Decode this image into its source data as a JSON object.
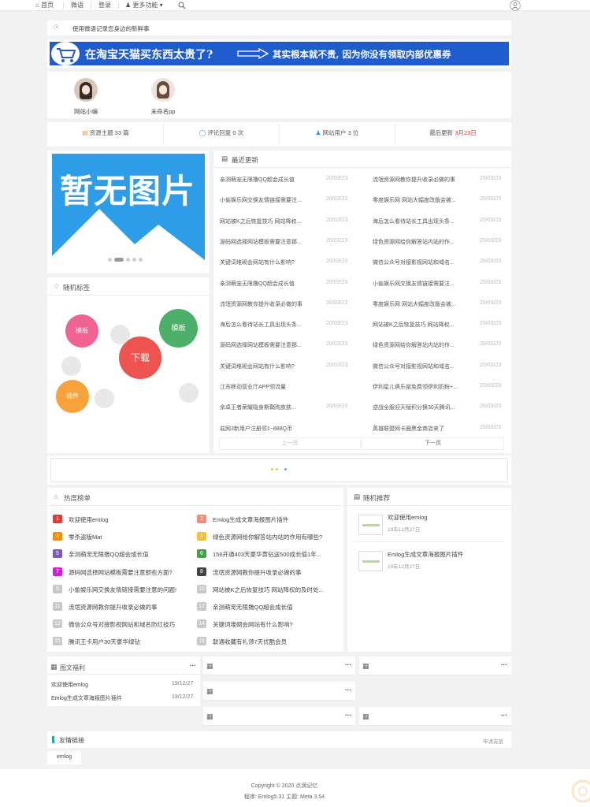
{
  "nav": {
    "home": "首页",
    "weibo": "微语",
    "login": "登录",
    "more": "更多功能"
  },
  "notice": "使用微语记录您身边的新鲜事",
  "banner": {
    "left": "在淘宝天猫买东西太贵了?",
    "right": "其实根本就不贵, 因为你没有领取内部优惠券",
    "color": "#1e5ccf"
  },
  "users": [
    {
      "name": "网站小编"
    },
    {
      "name": "未命名pp"
    }
  ],
  "stats": {
    "topics": "资源主题 33 篇",
    "comments": "评论回复 0 次",
    "users": "网站用户 3 位",
    "updated_label": "最后更新",
    "updated_date": "3月23日"
  },
  "placeholder_text": "暂无图片",
  "recent": {
    "title": "最近更新",
    "items": [
      [
        "亲测萌宠无限撸QQ超会成长值",
        "20/03/23",
        "流氓资源网教你提升收录必做的事",
        "20/03/23"
      ],
      [
        "小偷娱乐网交换友情链接需要注...",
        "20/03/23",
        "零度娱乐网 网站大幅度改版会被...",
        "20/03/23"
      ],
      [
        "网站被K之后恢复技巧 网站降权...",
        "20/03/23",
        "海后怎么看待站长工具出现头条...",
        "20/03/23"
      ],
      [
        "源码网选择网站模板需要注意那...",
        "20/03/23",
        "绿色资源网给你解答站内站的作...",
        "20/03/23"
      ],
      [
        "关键词堆砌会网站有什么影响?",
        "20/03/23",
        "微信公众号对接影视网站和域名...",
        "20/03/23"
      ],
      [
        "亲测萌宠无限撸QQ超会成长值",
        "20/03/23",
        "小偷娱乐网交换友情链接需要注...",
        "20/03/23"
      ],
      [
        "流氓资源网教你提升收录必做的事",
        "20/03/23",
        "零度娱乐网 网站大幅度改版会被...",
        "20/03/23"
      ],
      [
        "海后怎么看待站长工具出现头条...",
        "20/03/23",
        "网站被K之后恢复技巧 网站降权...",
        "20/03/23"
      ],
      [
        "源码网选择网站模板需要注意那...",
        "20/03/23",
        "绿色资源网给你解答站内站的作...",
        "20/03/23"
      ],
      [
        "关键词堆砌会网站有什么影响?",
        "20/03/23",
        "微信公众号对接影视网站和域名...",
        "20/03/23"
      ],
      [
        "江苏移动营业厅APP领流量",
        "",
        "伊利星儿俱乐部免费领伊利奶粉+...",
        "20/03/23"
      ],
      [
        "余卓王者荣耀隐身斯鞘殉皮肤...",
        "20/03/23",
        "逆战全服迎天赋积分换30天腾讯...",
        "20/03/23"
      ],
      [
        "兹网3新用户注册领1~888Q币",
        "",
        "英雄联盟网卡圈黑金商店来了",
        "20/03/23"
      ]
    ],
    "prev": "上一页",
    "next": "下一页"
  },
  "tags": {
    "title": "随机标签",
    "items": [
      {
        "label": "模板",
        "color": "#f06292"
      },
      {
        "label": "模板",
        "color": "#4caf6a"
      },
      {
        "label": "下载",
        "color": "#ef5350"
      },
      {
        "label": "插件",
        "color": "#f7a23a"
      }
    ]
  },
  "hot": {
    "title": "热度榜单",
    "items": [
      {
        "n": "1",
        "t": "欢迎使用emlog",
        "c": "#e53935"
      },
      {
        "n": "2",
        "t": "Emlog生成文章海报图片插件",
        "c": "#f28c7f"
      },
      {
        "n": "3",
        "t": "零杀盗版Mat",
        "c": "#fb8c00"
      },
      {
        "n": "4",
        "t": "绿色资源网给你解答站内站的作用有哪些?",
        "c": "#fbc02d"
      },
      {
        "n": "5",
        "t": "亲测萌宠无限撸QQ超会成长值",
        "c": "#7e57c2"
      },
      {
        "n": "6",
        "t": "156开通403天豪华黄钻送500成长值1年...",
        "c": "#43a047"
      },
      {
        "n": "7",
        "t": "源码网选择网站模板需要注意那些方面?",
        "c": "#d81bd8"
      },
      {
        "n": "8",
        "t": "流氓资源网教你提升收录必做的事",
        "c": "#424242"
      },
      {
        "n": "9",
        "t": "小偷娱乐网交换友情链接需要注意的问题!",
        "c": "#c8c8c8"
      },
      {
        "n": "10",
        "t": "网站被K之后恢复技巧 网站降权的及时处...",
        "c": "#c8c8c8"
      },
      {
        "n": "11",
        "t": "流氓资源网教你提升收录必做的事",
        "c": "#c8c8c8"
      },
      {
        "n": "12",
        "t": "亲测萌宠无限撸QQ超会成长值",
        "c": "#c8c8c8"
      },
      {
        "n": "13",
        "t": "微信公众号对接影视网站和域名防红技巧",
        "c": "#c8c8c8"
      },
      {
        "n": "14",
        "t": "关键词堆砌会网站有什么影响?",
        "c": "#c8c8c8"
      },
      {
        "n": "15",
        "t": "腾讯王卡用户30天豪华绿钻",
        "c": "#c8c8c8"
      },
      {
        "n": "16",
        "t": "联通收藏有礼领7天优酷会员",
        "c": "#c8c8c8"
      }
    ]
  },
  "random_rec": {
    "title": "随机推荐",
    "items": [
      {
        "t": "欢迎使用emlog",
        "d": "19年12月27日"
      },
      {
        "t": "Emlog生成文章海报图片插件",
        "d": "19年12月27日"
      }
    ]
  },
  "tuwen": {
    "title": "图文福利",
    "items": [
      {
        "t": "欢迎使用emlog",
        "d": "19/12/27"
      },
      {
        "t": "Emlog生成文章海报图片插件",
        "d": "19/12/27"
      }
    ]
  },
  "friends": {
    "title": "友情链接",
    "apply": "申请友链",
    "items": [
      "emlog"
    ]
  },
  "footer": {
    "copyright": "Copyright © 2020  点滴记忆",
    "powered": "程序: Emlog5.31    主题: Meta 3.54"
  }
}
